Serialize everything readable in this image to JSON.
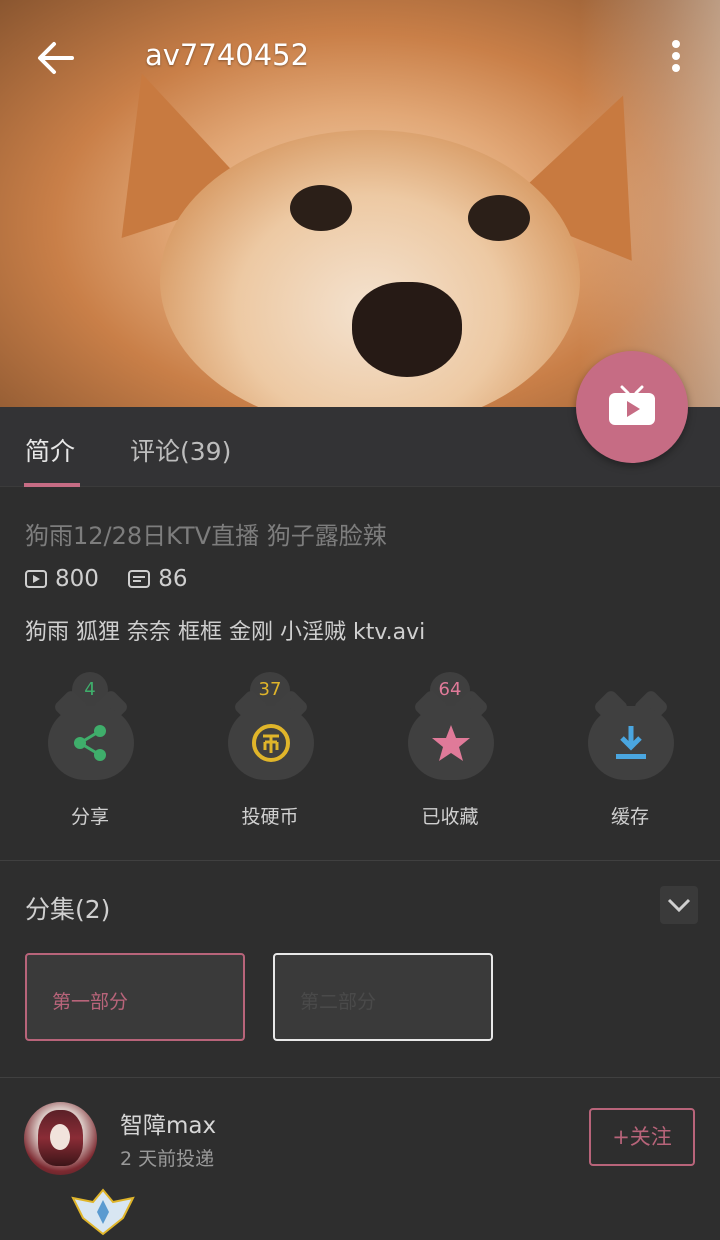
{
  "header": {
    "title": "av7740452",
    "image": "dog-face-thumbnail"
  },
  "tabs": [
    {
      "label": "简介",
      "active": true
    },
    {
      "label": "评论(39)",
      "active": false
    }
  ],
  "video": {
    "title": "狗雨12/28日KTV直播 狗子露脸辣",
    "plays": "800",
    "danmaku": "86",
    "description": "狗雨 狐狸 奈奈 框框 金刚 小淫贼 ktv.avi"
  },
  "actions": [
    {
      "label": "分享",
      "count": "4",
      "icon": "share-icon",
      "color": "#3fae6b"
    },
    {
      "label": "投硬币",
      "count": "37",
      "icon": "coin-icon",
      "color": "#e0b52a"
    },
    {
      "label": "已收藏",
      "count": "64",
      "icon": "star-icon",
      "color": "#e07a99"
    },
    {
      "label": "缓存",
      "count": "",
      "icon": "download-icon",
      "color": "#4aa6e0"
    }
  ],
  "episodes": {
    "title": "分集(2)",
    "items": [
      {
        "label": "第一部分",
        "selected": true
      },
      {
        "label": "第二部分",
        "selected": false
      }
    ]
  },
  "uploader": {
    "name": "智障max",
    "time": "2 天前投递",
    "follow_label": "+关注"
  },
  "colors": {
    "accent": "#c66c84",
    "background": "#2e2e2e"
  }
}
